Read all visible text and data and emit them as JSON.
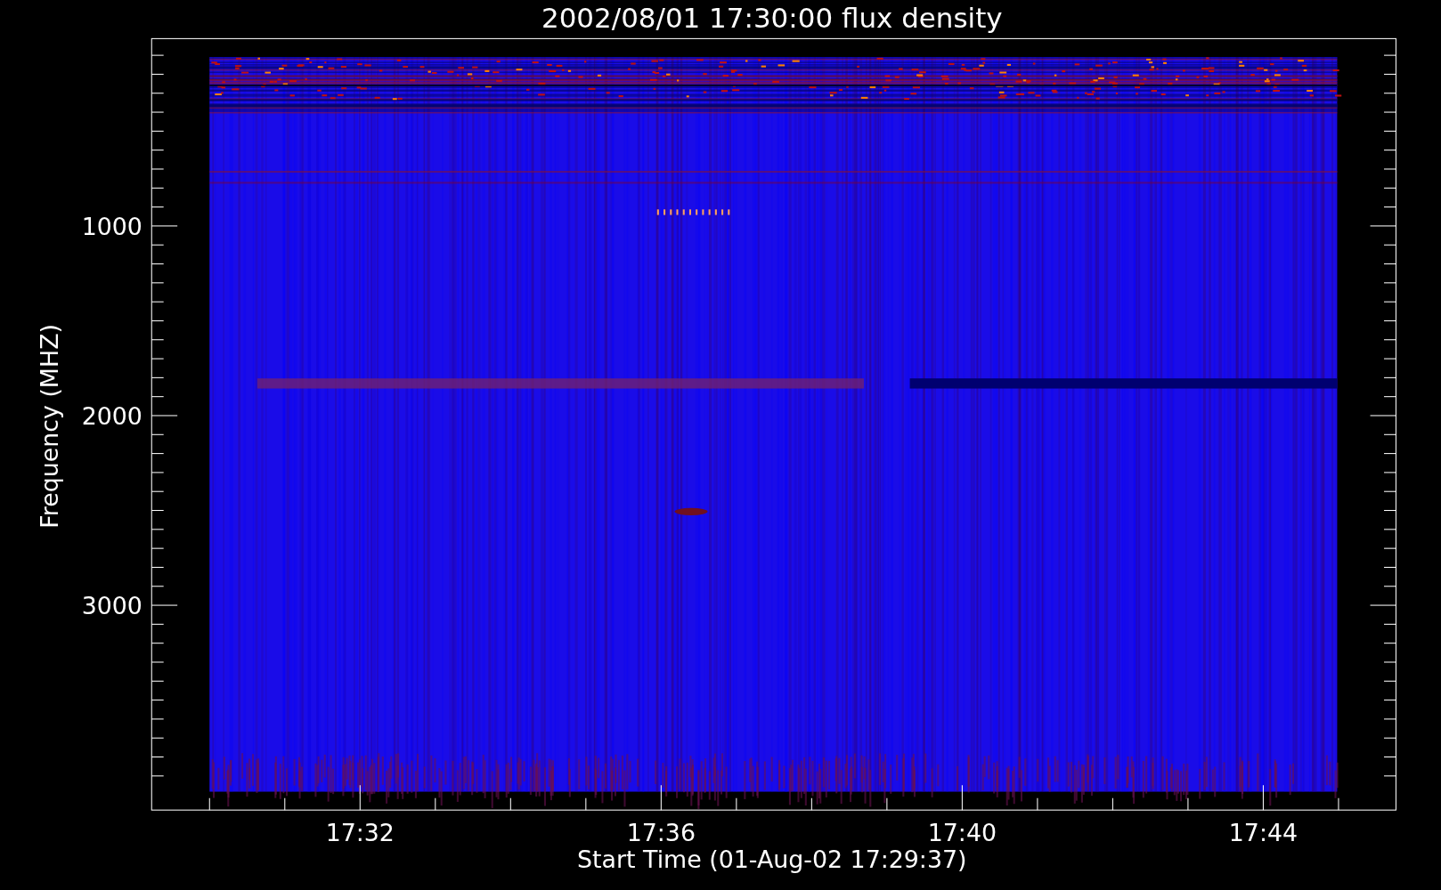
{
  "plot": {
    "title": "2002/08/01 17:30:00 flux density",
    "x_axis": {
      "label": "Start Time (01-Aug-02 17:29:37)",
      "ticks": [
        "17:32",
        "17:36",
        "17:40",
        "17:44"
      ]
    },
    "y_axis": {
      "label": "Frequency (MHZ)",
      "ticks": [
        "1000",
        "2000",
        "3000"
      ]
    }
  }
}
